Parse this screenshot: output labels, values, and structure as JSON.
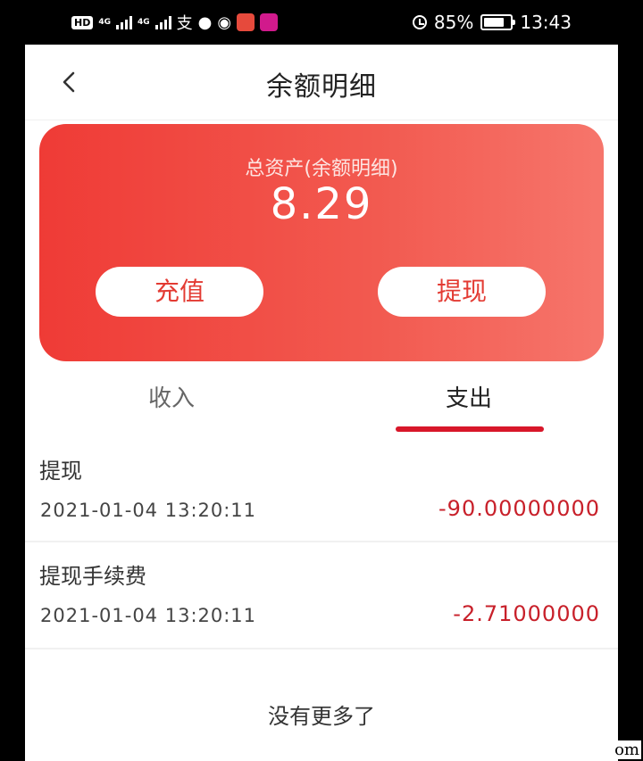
{
  "status_bar": {
    "hd_badge": "HD",
    "network_1": "4G",
    "network_2": "4G",
    "alipay_glyph": "支",
    "battery_percent": "85%",
    "time": "13:43"
  },
  "nav": {
    "title": "余额明细",
    "back_icon": "chevron-left-icon"
  },
  "balance_card": {
    "label": "总资产(余额明细)",
    "amount": "8.29",
    "recharge_label": "充值",
    "withdraw_label": "提现",
    "gradient_colors": [
      "#ef3b36",
      "#f6756b"
    ]
  },
  "tabs": {
    "income_label": "收入",
    "expense_label": "支出",
    "active": "支出",
    "accent_color": "#d8172a"
  },
  "transactions": [
    {
      "title": "提现",
      "time": "2021-01-04 13:20:11",
      "amount": "-90.00000000"
    },
    {
      "title": "提现手续费",
      "time": "2021-01-04 13:20:11",
      "amount": "-2.71000000"
    }
  ],
  "footer": {
    "no_more_label": "没有更多了"
  },
  "corner_text": "om"
}
